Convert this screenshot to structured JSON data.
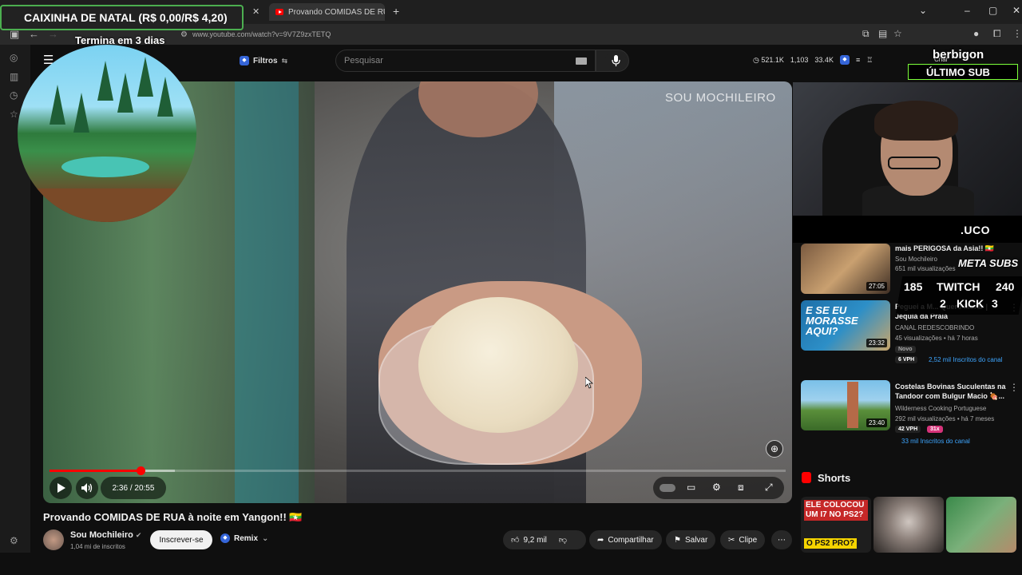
{
  "browser": {
    "active_tab": "Provando COMIDAS DE RUA à n",
    "url": "www.youtube.com/watch?v=9V7Z9zxTETQ"
  },
  "overlays": {
    "caixinha": "CAIXINHA DE NATAL (R$ 0,00/R$ 4,20)",
    "termina": "Termina em 3 dias",
    "streamer": "berbigon",
    "criar": "Criar",
    "ultimo_sub": "ÚLTIMO SUB",
    "uco": ".UCO",
    "meta_subs": "META SUBS",
    "twitch_count": "185",
    "twitch_label": "TWITCH",
    "twitch_goal": "240",
    "kick_count": "2",
    "kick_label": "KICK",
    "kick_goal": "3"
  },
  "header": {
    "filtros": "Filtros",
    "search_placeholder": "Pesquisar",
    "stats": [
      "521.1K",
      "1,103",
      "33.4K"
    ]
  },
  "video": {
    "watermark": "SOU MOCHILEIRO",
    "time": "2:36 / 20:55",
    "progress": 0.124,
    "buffered": 0.17,
    "title": "Provando COMIDAS DE RUA à noite em Yangon!! 🇲🇲"
  },
  "channel": {
    "name": "Sou Mochileiro",
    "subs": "1,04 mi de inscritos",
    "subscribe": "Inscrever-se",
    "remix": "Remix"
  },
  "actions": {
    "likes": "9,2 mil",
    "share": "Compartilhar",
    "save": "Salvar",
    "clip": "Clipe"
  },
  "recommendations": [
    {
      "title": "mais PERIGOSA da Asia!! 🇲🇲",
      "channel": "Sou Mochileiro",
      "views": "651 mil visualizações",
      "duration": "27:05"
    },
    {
      "title": "Peguei a M... Quero Morar | Jequiá da Praia",
      "channel": "CANAL REDESCOBRINDO",
      "views": "45 visualizações • há 7 horas",
      "badge": "Novo",
      "vph": "6 VPH",
      "inscritos": "2,52 mil Inscritos do canal",
      "duration": "23:32",
      "thumb_text": "E SE EU MORASSE AQUI?"
    },
    {
      "title": "Costelas Bovinas Suculentas na Tandoor com Bulgur Macio 🍖...",
      "channel": "Wilderness Cooking Portuguese",
      "views": "292 mil visualizações • há 7 meses",
      "vph": "42 VPH",
      "multiplier": "31x",
      "inscritos": "33 mil Inscritos do canal",
      "duration": "23:40"
    }
  ],
  "shorts": {
    "label": "Shorts",
    "items": [
      {
        "text_top": "ELE COLOCOU UM I7 NO PS2?",
        "text_bottom": "O PS2 PRO?"
      },
      {
        "text_top": ""
      },
      {
        "text_top": ""
      }
    ]
  }
}
